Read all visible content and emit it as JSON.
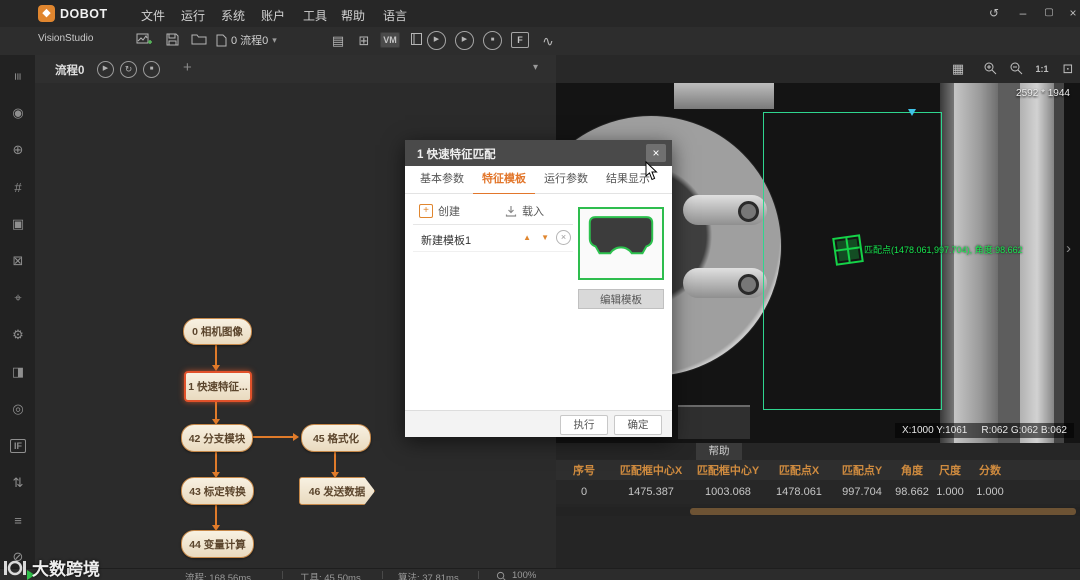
{
  "colors": {
    "accent_orange": "#e0862f",
    "node_border": "#c6894a",
    "selected_node": "#e1512a",
    "match_green": "#17e84f",
    "roi_teal": "#2fd58f",
    "table_header": "#cf8b3f"
  },
  "titlebar": {
    "brand": "DOBOT",
    "product": "VisionStudio",
    "menus": [
      "文件",
      "运行",
      "系统",
      "账户",
      "工具",
      "帮助",
      "语言"
    ]
  },
  "toolbar": {
    "process_selector": "0 流程0",
    "vm_badge": "VM",
    "f_badge": "F"
  },
  "flow": {
    "title": "流程0",
    "add_tab": "+",
    "nodes": [
      "0 相机图像",
      "1 快速特征...",
      "42 分支模块",
      "45 格式化",
      "43 标定转换",
      "46 发送数据",
      "44 变量计算"
    ]
  },
  "left_toolbar": {
    "if_label": "IF"
  },
  "view": {
    "resolution": "2592 * 1944",
    "zoom_actual": "1:1",
    "match_label": "匹配点(1478.061,997.704), 角度:98.662",
    "pixel_xy": "X:1000 Y:1061",
    "pixel_rgb": "R:062 G:062 B:062",
    "help_tab": "帮助",
    "expand_chevron": "›"
  },
  "dialog": {
    "title": "1 快速特征匹配",
    "tabs": [
      "基本参数",
      "特征模板",
      "运行参数",
      "结果显示"
    ],
    "create_label": "创建",
    "load_label": "载入",
    "template_name": "新建模板1",
    "edit_template_label": "编辑模板",
    "execute_label": "执行",
    "confirm_label": "确定"
  },
  "results": {
    "headers": [
      "序号",
      "匹配框中心X",
      "匹配框中心Y",
      "匹配点X",
      "匹配点Y",
      "角度",
      "尺度",
      "分数"
    ],
    "row": [
      "0",
      "1475.387",
      "1003.068",
      "1478.061",
      "997.704",
      "98.662",
      "1.000",
      "1.000"
    ]
  },
  "statusbar": {
    "flow_time": "流程: 168.56ms",
    "tool_time": "工具: 45.50ms",
    "algo_time": "算法: 37.81ms",
    "zoom": "100%"
  },
  "watermark": {
    "text": "大数跨境"
  }
}
